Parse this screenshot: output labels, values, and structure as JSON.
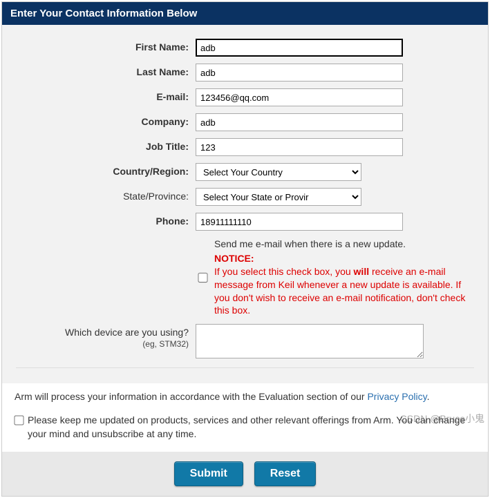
{
  "header": {
    "title": "Enter Your Contact Information Below"
  },
  "labels": {
    "first_name": "First Name:",
    "last_name": "Last Name:",
    "email": "E-mail:",
    "company": "Company:",
    "job_title": "Job Title:",
    "country": "Country/Region:",
    "state": "State/Province:",
    "phone": "Phone:",
    "device_line1": "Which device are you using?",
    "device_line2": "(eg, STM32)"
  },
  "values": {
    "first_name": "adb",
    "last_name": "adb",
    "email": "123456@qq.com",
    "company": "adb",
    "job_title": "123",
    "phone": "18911111110",
    "device": ""
  },
  "selects": {
    "country_selected": "Select Your Country",
    "state_selected": "Select Your State or Provir"
  },
  "email_update": {
    "label": "Send me e-mail when there is a new update.",
    "notice_heading": "NOTICE:",
    "notice_pre": "If you select this check box, you ",
    "notice_bold": "will",
    "notice_post": " receive an e-mail message from Keil whenever a new update is available. If you don't wish to receive an e-mail notification, don't check this box."
  },
  "policy": {
    "text_pre": "Arm will process your information in accordance with the Evaluation section of our ",
    "link_text": "Privacy Policy",
    "text_post": ".",
    "updates_text": "Please keep me updated on products, services and other relevant offerings from Arm. You can change your mind and unsubscribe at any time."
  },
  "buttons": {
    "submit": "Submit",
    "reset": "Reset"
  },
  "watermark": "CSDN @Bruce小鬼"
}
